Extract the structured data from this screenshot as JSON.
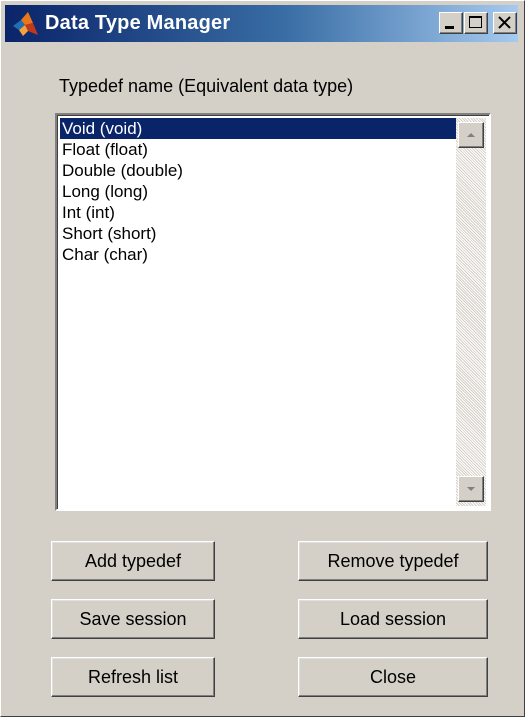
{
  "window": {
    "title": "Data Type Manager",
    "icon": "matlab-logo-icon"
  },
  "title_buttons": {
    "minimize": "minimize-icon",
    "maximize": "maximize-icon",
    "close": "close-icon"
  },
  "typedef_list": {
    "label": "Typedef name (Equivalent data type)",
    "selected_index": 0,
    "items": [
      "Void (void)",
      "Float (float)",
      "Double (double)",
      "Long (long)",
      "Int (int)",
      "Short (short)",
      "Char (char)"
    ]
  },
  "buttons": {
    "add_typedef": "Add typedef",
    "remove_typedef": "Remove typedef",
    "save_session": "Save session",
    "load_session": "Load session",
    "refresh_list": "Refresh list",
    "close": "Close"
  },
  "colors": {
    "title_bar_start": "#0a246a",
    "title_bar_end": "#a6caf0",
    "selection": "#0a246a",
    "face": "#d4d0c8"
  }
}
